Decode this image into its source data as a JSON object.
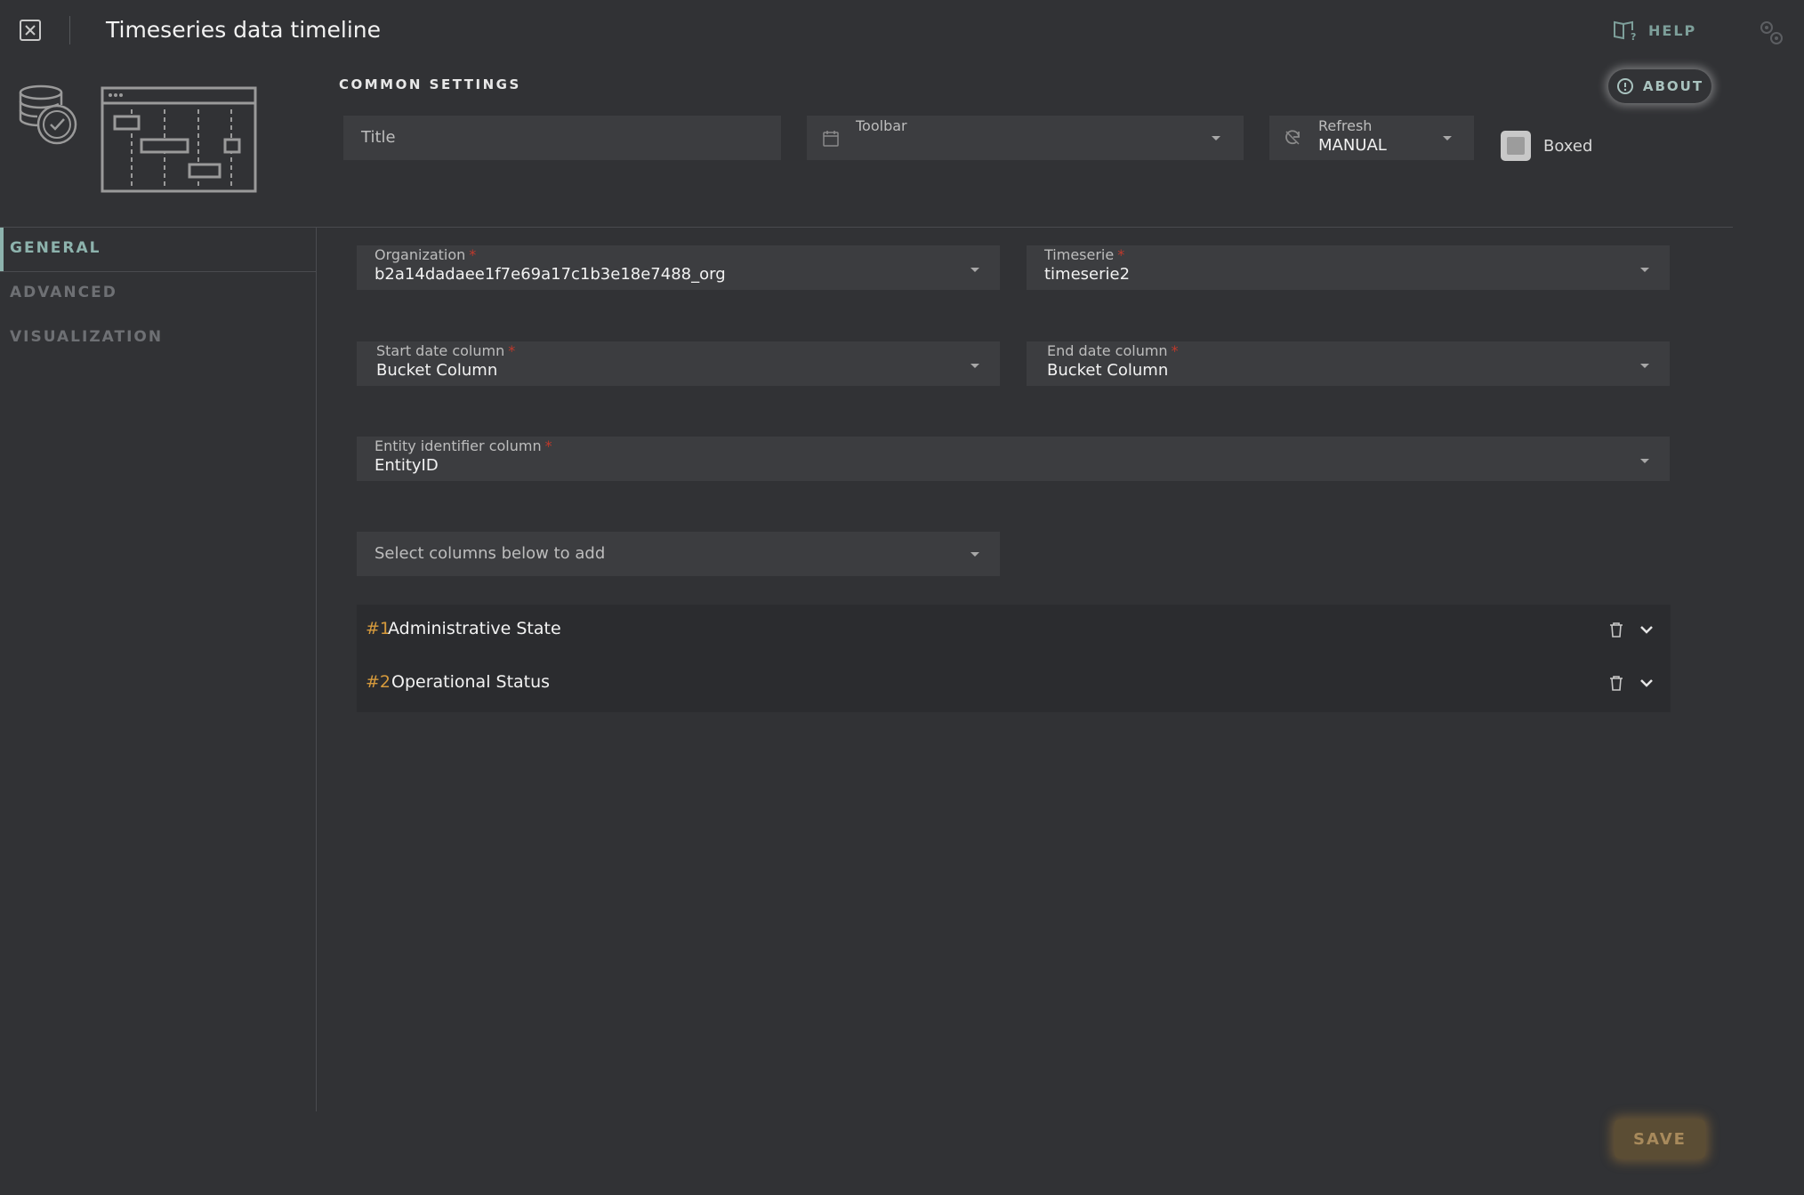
{
  "header": {
    "title": "Timeseries data timeline",
    "help_label": "HELP"
  },
  "common_settings": {
    "section_label": "COMMON SETTINGS",
    "about_label": "ABOUT",
    "title_placeholder": "Title",
    "toolbar_label": "Toolbar",
    "toolbar_value": "",
    "refresh_label": "Refresh",
    "refresh_value": "MANUAL",
    "boxed_label": "Boxed",
    "boxed_checked": false
  },
  "sidebar": {
    "items": [
      {
        "label": "GENERAL",
        "active": true
      },
      {
        "label": "ADVANCED",
        "active": false
      },
      {
        "label": "VISUALIZATION",
        "active": false
      }
    ]
  },
  "form": {
    "organization": {
      "label": "Organization",
      "value": "b2a14dadaee1f7e69a17c1b3e18e7488_org"
    },
    "timeserie": {
      "label": "Timeserie",
      "value": "timeserie2"
    },
    "start_date": {
      "label": "Start date column",
      "value": "Bucket Column"
    },
    "end_date": {
      "label": "End date column",
      "value": "Bucket Column"
    },
    "entity_id": {
      "label": "Entity identifier column",
      "value": "EntityID"
    },
    "columns_select": {
      "placeholder": "Select columns below to add"
    },
    "required_marker": "*"
  },
  "columns": [
    {
      "num": "#1",
      "name": "Administrative State"
    },
    {
      "num": "#2",
      "name": "Operational Status"
    }
  ],
  "footer": {
    "save_label": "SAVE"
  },
  "colors": {
    "background": "#313235",
    "accent": "#8db3ad",
    "number_accent": "#d69a3c",
    "save": "#5b4d34"
  }
}
